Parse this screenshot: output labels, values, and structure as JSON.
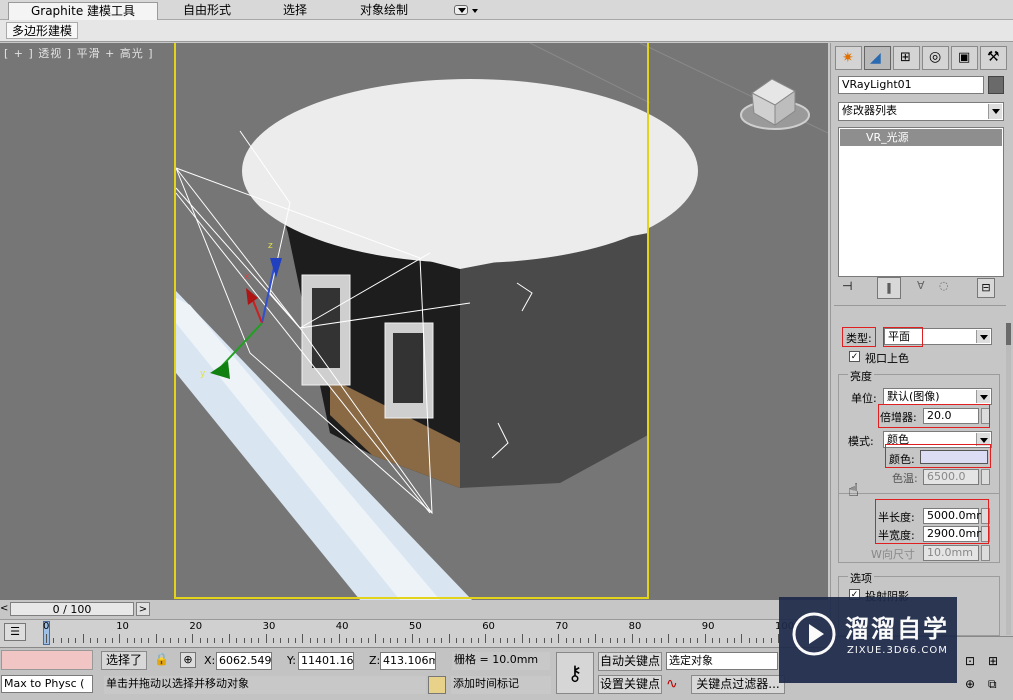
{
  "ribbon": {
    "tabs": [
      {
        "label": "Graphite 建模工具",
        "active": true
      },
      {
        "label": "自由形式",
        "active": false
      },
      {
        "label": "选择",
        "active": false
      },
      {
        "label": "对象绘制",
        "active": false
      }
    ],
    "subtab": "多边形建模"
  },
  "viewport": {
    "label": "[ + ] 透视 ] 平滑 + 高光 ]",
    "gizmo_axes": {
      "x": "x",
      "y": "y",
      "z": "z"
    }
  },
  "command_panel": {
    "object_name": "VRayLight01",
    "modifier_list": "修改器列表",
    "stack_item": "VR_光源",
    "params": {
      "type_label": "类型:",
      "type_value": "平面",
      "viewport_color_label": "视口上色",
      "brightness_header": "亮度",
      "unit_label": "单位:",
      "unit_value": "默认(图像)",
      "multiplier_label": "倍增器:",
      "multiplier_value": "20.0",
      "mode_label": "模式:",
      "mode_value": "颜色",
      "color_label": "颜色:",
      "temp_label": "色温:",
      "temp_value": "6500.0",
      "half_length_label": "半长度:",
      "half_length_value": "5000.0mm",
      "half_width_label": "半宽度:",
      "half_width_value": "2900.0mm",
      "w_size_label": "W向尺寸",
      "w_size_value": "10.0mm",
      "options_header": "选项",
      "cast_shadows_label": "投射阴影"
    },
    "colors": {
      "light_color": "#dcdcf4",
      "highlight_box": "#e02020"
    }
  },
  "timeline": {
    "slider": "0 / 100",
    "ticks": [
      "0",
      "10",
      "20",
      "30",
      "40",
      "50",
      "60",
      "70",
      "80",
      "90",
      "100"
    ]
  },
  "status": {
    "script_text": "Max to Physc (",
    "selected": "选择了",
    "x_label": "X:",
    "x_value": "6062.549m",
    "y_label": "Y:",
    "y_value": "11401.165",
    "z_label": "Z:",
    "z_value": "413.106mm",
    "grid": "栅格 = 10.0mm",
    "auto_key": "自动关键点",
    "set_key": "设置关键点",
    "selection_set": "选定对象",
    "key_filters": "关键点过滤器...",
    "prompt": "单击并拖动以选择并移动对象",
    "add_time_tag": "添加时间标记"
  },
  "watermark": {
    "brand": "溜溜自学",
    "url": "ZIXUE.3D66.COM"
  }
}
